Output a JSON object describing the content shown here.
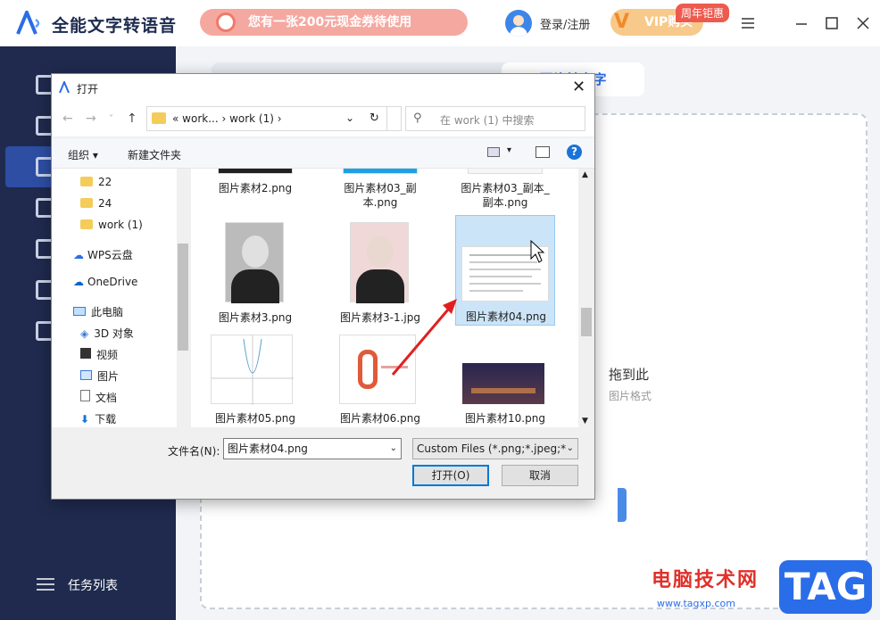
{
  "app": {
    "title": "全能文字转语音",
    "coupon_text": "您有一张200元现金券待使用",
    "login_label": "登录/注册",
    "vip_label": "VIP购买",
    "vip_badge": "周年钜惠",
    "brand_color": "#2a6de8"
  },
  "sidebar": {
    "task_list_label": "任务列表"
  },
  "main": {
    "active_tab": "图片转文字",
    "drop_text": "拖到此",
    "drop_sub": "图片格式"
  },
  "dialog": {
    "title": "打开",
    "address_path": "«  work...  ›  work (1)  ›",
    "search_placeholder": "在 work (1) 中搜索",
    "organize_label": "组织 ▾",
    "new_folder_label": "新建文件夹",
    "tree": [
      {
        "label": "22",
        "icon": "folder-icon"
      },
      {
        "label": "24",
        "icon": "folder-icon"
      },
      {
        "label": "work (1)",
        "icon": "folder-icon"
      },
      {
        "label": "WPS云盘",
        "icon": "cloud-icon"
      },
      {
        "label": "OneDrive",
        "icon": "onedrive-icon"
      },
      {
        "label": "此电脑",
        "icon": "computer-icon"
      },
      {
        "label": "3D 对象",
        "icon": "cube-icon"
      },
      {
        "label": "视频",
        "icon": "video-icon"
      },
      {
        "label": "图片",
        "icon": "picture-icon"
      },
      {
        "label": "文档",
        "icon": "document-icon"
      },
      {
        "label": "下载",
        "icon": "download-icon"
      }
    ],
    "files": [
      {
        "name": "图片素材2.png"
      },
      {
        "name": "图片素材03_副本.png"
      },
      {
        "name": "图片素材03_副本_副本.png"
      },
      {
        "name": "图片素材3.png"
      },
      {
        "name": "图片素材3-1.jpg"
      },
      {
        "name": "图片素材04.png",
        "selected": true
      },
      {
        "name": "图片素材05.png"
      },
      {
        "name": "图片素材06.png"
      },
      {
        "name": "图片素材10.png"
      }
    ],
    "filename_label": "文件名(N):",
    "filename_value": "图片素材04.png",
    "filetype_value": "Custom Files (*.png;*.jpeg;*.j",
    "open_label": "打开(O)",
    "cancel_label": "取消"
  },
  "watermark": {
    "site_name": "电脑技术网",
    "url": "www.tagxp.com",
    "tag": "TAG"
  }
}
